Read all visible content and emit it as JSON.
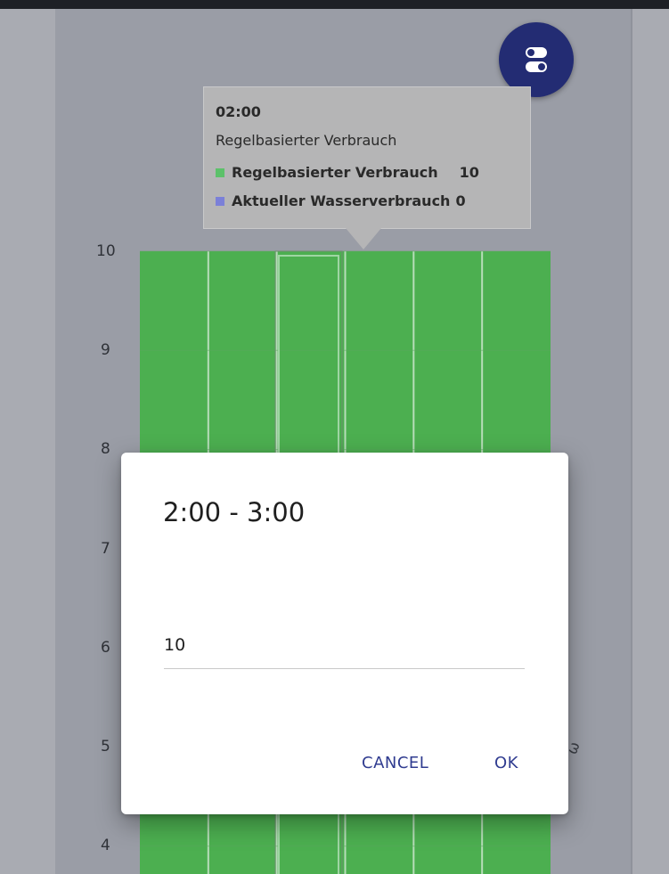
{
  "tooltip": {
    "time": "02:00",
    "subtitle": "Regelbasierter Verbrauch",
    "rows": [
      {
        "label": "Regelbasierter Verbrauch",
        "value": "10",
        "color": "#5cc16a"
      },
      {
        "label": "Aktueller Wasserverbrauch",
        "value": "0",
        "color": "#7b80d8"
      }
    ]
  },
  "chart": {
    "y_ticks": [
      "10",
      "9",
      "8",
      "7",
      "6",
      "5",
      "4"
    ],
    "bar_color": "#4caf50",
    "series_values": [
      10,
      10,
      10,
      10,
      10,
      10
    ]
  },
  "dialog": {
    "title": "2:00 - 3:00",
    "input_value": "10",
    "cancel_label": "CANCEL",
    "ok_label": "OK"
  },
  "fab": {
    "icon": "toggle-icon",
    "color": "#232c73"
  }
}
